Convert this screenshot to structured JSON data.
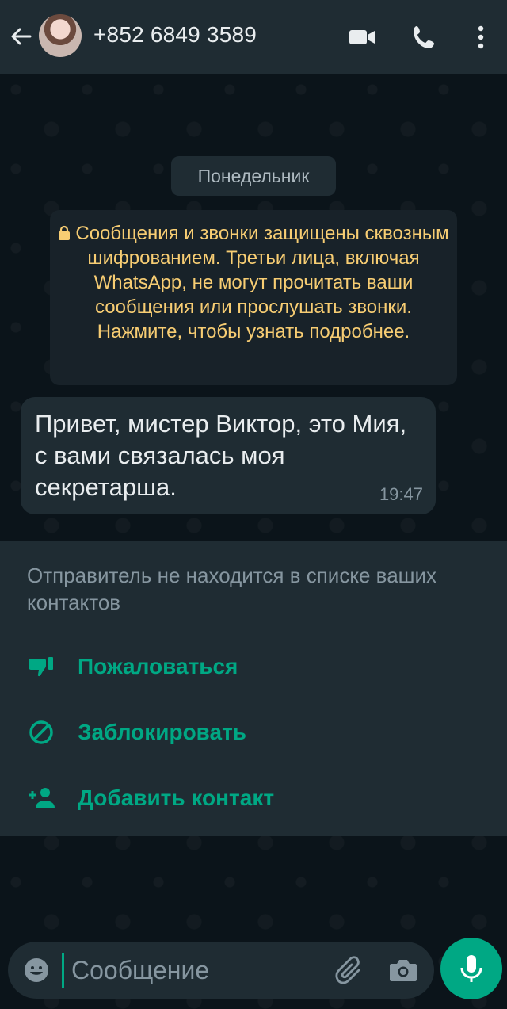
{
  "header": {
    "contact_name": "+852 6849 3589",
    "icons": [
      "back-arrow-icon",
      "video-call-icon",
      "voice-call-icon",
      "more-options-icon"
    ]
  },
  "chat": {
    "date_label": "Понедельник",
    "encryption_notice": "Сообщения и звонки защищены сквозным шифрованием. Третьи лица, включая WhatsApp, не могут прочитать ваши сообщения или прослушать звонки. Нажмите, чтобы узнать подробнее.",
    "messages": [
      {
        "text": "Привет, мистер Виктор, это Мия, с вами связалась моя секретарша.",
        "time": "19:47"
      }
    ]
  },
  "unknown_contact": {
    "note": "Отправитель не находится в списке ваших контактов",
    "actions": [
      {
        "label": "Пожаловаться",
        "icon": "thumbs-down-icon"
      },
      {
        "label": "Заблокировать",
        "icon": "block-icon"
      },
      {
        "label": "Добавить контакт",
        "icon": "add-person-icon"
      }
    ]
  },
  "composer": {
    "placeholder": "Сообщение",
    "icons": [
      "emoji-icon",
      "attach-icon",
      "camera-icon",
      "mic-icon"
    ]
  },
  "colors": {
    "accent": "#00a884",
    "header_bg": "#1f2c33",
    "chat_bg": "#0b141a",
    "notice_text": "#f7cd73"
  }
}
